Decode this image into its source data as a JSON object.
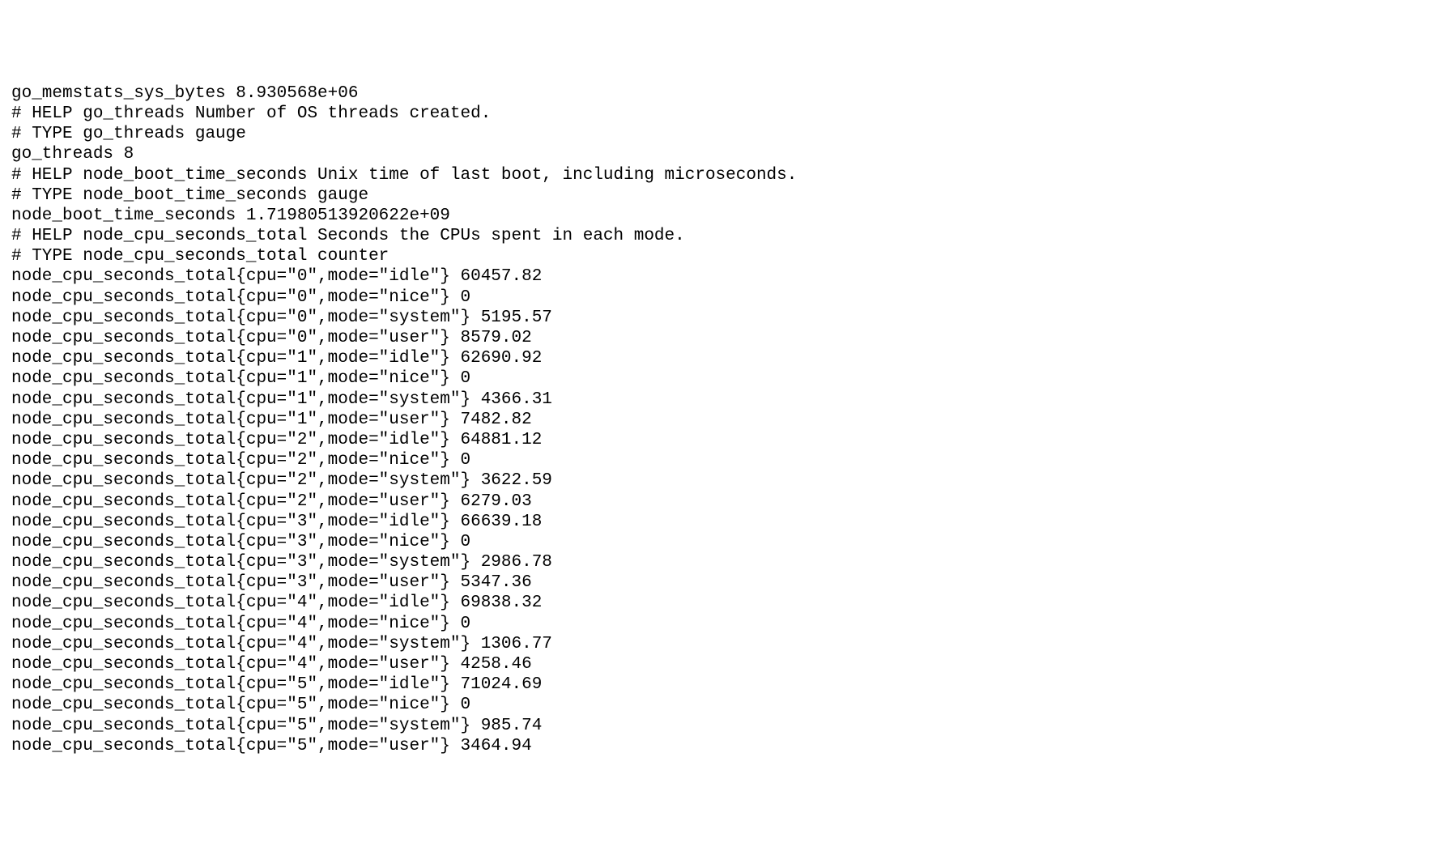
{
  "lines": [
    "go_memstats_sys_bytes 8.930568e+06",
    "# HELP go_threads Number of OS threads created.",
    "# TYPE go_threads gauge",
    "go_threads 8",
    "# HELP node_boot_time_seconds Unix time of last boot, including microseconds.",
    "# TYPE node_boot_time_seconds gauge",
    "node_boot_time_seconds 1.71980513920622e+09",
    "# HELP node_cpu_seconds_total Seconds the CPUs spent in each mode.",
    "# TYPE node_cpu_seconds_total counter",
    "node_cpu_seconds_total{cpu=\"0\",mode=\"idle\"} 60457.82",
    "node_cpu_seconds_total{cpu=\"0\",mode=\"nice\"} 0",
    "node_cpu_seconds_total{cpu=\"0\",mode=\"system\"} 5195.57",
    "node_cpu_seconds_total{cpu=\"0\",mode=\"user\"} 8579.02",
    "node_cpu_seconds_total{cpu=\"1\",mode=\"idle\"} 62690.92",
    "node_cpu_seconds_total{cpu=\"1\",mode=\"nice\"} 0",
    "node_cpu_seconds_total{cpu=\"1\",mode=\"system\"} 4366.31",
    "node_cpu_seconds_total{cpu=\"1\",mode=\"user\"} 7482.82",
    "node_cpu_seconds_total{cpu=\"2\",mode=\"idle\"} 64881.12",
    "node_cpu_seconds_total{cpu=\"2\",mode=\"nice\"} 0",
    "node_cpu_seconds_total{cpu=\"2\",mode=\"system\"} 3622.59",
    "node_cpu_seconds_total{cpu=\"2\",mode=\"user\"} 6279.03",
    "node_cpu_seconds_total{cpu=\"3\",mode=\"idle\"} 66639.18",
    "node_cpu_seconds_total{cpu=\"3\",mode=\"nice\"} 0",
    "node_cpu_seconds_total{cpu=\"3\",mode=\"system\"} 2986.78",
    "node_cpu_seconds_total{cpu=\"3\",mode=\"user\"} 5347.36",
    "node_cpu_seconds_total{cpu=\"4\",mode=\"idle\"} 69838.32",
    "node_cpu_seconds_total{cpu=\"4\",mode=\"nice\"} 0",
    "node_cpu_seconds_total{cpu=\"4\",mode=\"system\"} 1306.77",
    "node_cpu_seconds_total{cpu=\"4\",mode=\"user\"} 4258.46",
    "node_cpu_seconds_total{cpu=\"5\",mode=\"idle\"} 71024.69",
    "node_cpu_seconds_total{cpu=\"5\",mode=\"nice\"} 0",
    "node_cpu_seconds_total{cpu=\"5\",mode=\"system\"} 985.74",
    "node_cpu_seconds_total{cpu=\"5\",mode=\"user\"} 3464.94"
  ]
}
